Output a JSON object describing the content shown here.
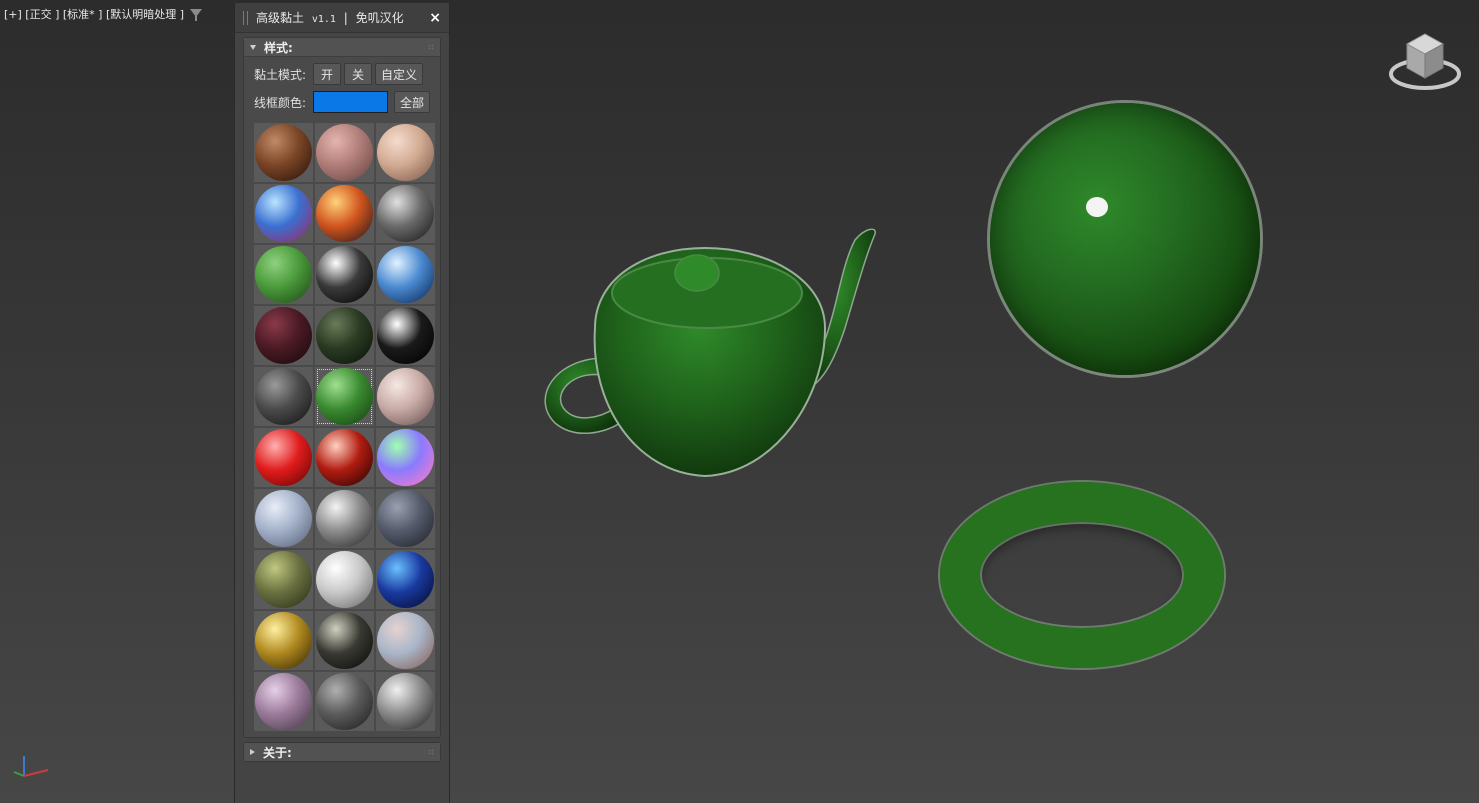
{
  "viewport": {
    "label": "[+] [正交 ] [标准* ] [默认明暗处理 ]"
  },
  "panel": {
    "title": "高级黏土",
    "version": "v1.1",
    "separator": "|",
    "subtitle": "免叽汉化",
    "close_label": "×",
    "style_rollout": {
      "title": "样式:",
      "clay_mode_label": "黏土模式:",
      "on_label": "开",
      "off_label": "关",
      "custom_label": "自定义",
      "wire_color_label": "线框颜色:",
      "wire_color": "#0a78e6",
      "all_label": "全部"
    },
    "about_rollout": {
      "title": "关于:"
    }
  },
  "materials": [
    "brown-clay",
    "pink-skin",
    "peach-skin",
    "blue-iridescent",
    "fire-orange",
    "dark-chrome",
    "green-clay",
    "black-chrome",
    "blue-glass",
    "maroon",
    "dark-green-metal",
    "black-mirror",
    "dark-gray-gloss",
    "green-selected",
    "pink-pearl",
    "red-gloss",
    "red-chrome",
    "normal-map",
    "pale-blue",
    "silver-glass",
    "slate-gray",
    "olive-sheen",
    "white-pearl",
    "deep-blue-iridescent",
    "gold",
    "dark-metal",
    "pastel-skin",
    "lilac-pearl",
    "rough-iron",
    "brushed-steel"
  ],
  "selected_material_index": 13,
  "colors": {
    "accent_green": "#26721f",
    "panel_bg": "#444444"
  }
}
